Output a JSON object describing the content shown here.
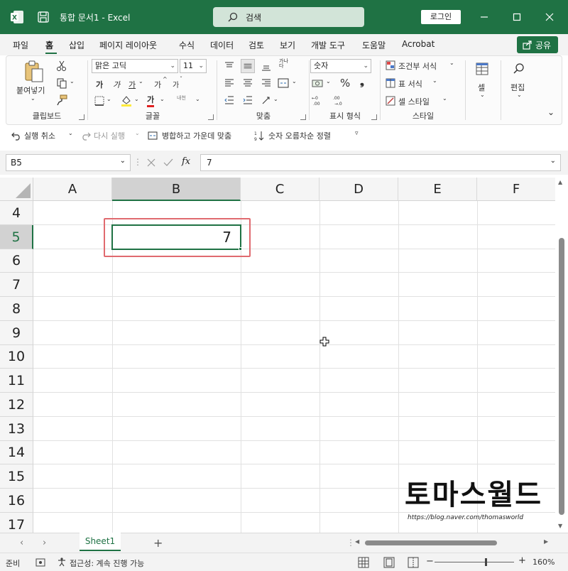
{
  "app": {
    "title": "통합 문서1  -  Excel",
    "search_placeholder": "검색",
    "login_label": "로그인",
    "accent_color": "#1f7244"
  },
  "menu": {
    "tabs": [
      "파일",
      "홈",
      "삽입",
      "페이지 레이아웃",
      "수식",
      "데이터",
      "검토",
      "보기",
      "개발 도구",
      "도움말",
      "Acrobat"
    ],
    "active_tab": "홈",
    "share_label": "공유"
  },
  "ribbon": {
    "clipboard": {
      "paste_label": "붙여넣기",
      "group_label": "클립보드"
    },
    "font": {
      "font_name": "맑은 고딕",
      "font_size": "11",
      "bold": "가",
      "italic": "가",
      "underline": "가",
      "grow": "가",
      "shrink": "가",
      "font_color_glyph": "가",
      "phonetic": "내천",
      "group_label": "글꼴"
    },
    "alignment": {
      "wrap_glyph": "가나다",
      "group_label": "맞춤"
    },
    "number": {
      "format": "숫자",
      "percent": "%",
      "comma": "❟",
      "group_label": "표시 형식"
    },
    "styles": {
      "conditional": "조건부 서식",
      "table": "표 서식",
      "cell_styles": "셀 스타일",
      "group_label": "스타일"
    },
    "cells": {
      "label": "셀"
    },
    "editing": {
      "label": "편집"
    }
  },
  "quick_access": {
    "undo": "실행 취소",
    "redo": "다시 실행",
    "merge": "병합하고 가운데 맞춤",
    "sort": "숫자 오름차순 정렬"
  },
  "formula_bar": {
    "name_box": "B5",
    "fx": "fx",
    "value": "7"
  },
  "grid": {
    "columns": [
      "A",
      "B",
      "C",
      "D",
      "E",
      "F"
    ],
    "selected_column": "B",
    "rows": [
      "4",
      "5",
      "6",
      "7",
      "8",
      "9",
      "10",
      "11",
      "12",
      "13",
      "14",
      "15",
      "16",
      "17"
    ],
    "selected_row": "5",
    "active_cell": {
      "ref": "B5",
      "value": "7"
    }
  },
  "watermark": {
    "title": "토마스월드",
    "url": "https://blog.naver.com/thomasworld"
  },
  "sheets": {
    "tabs": [
      "Sheet1"
    ],
    "active": "Sheet1",
    "add": "+"
  },
  "status": {
    "ready": "준비",
    "accessibility": "접근성: 계속 진행 가능",
    "zoom": "160%",
    "zoom_minus": "−",
    "zoom_plus": "+"
  }
}
